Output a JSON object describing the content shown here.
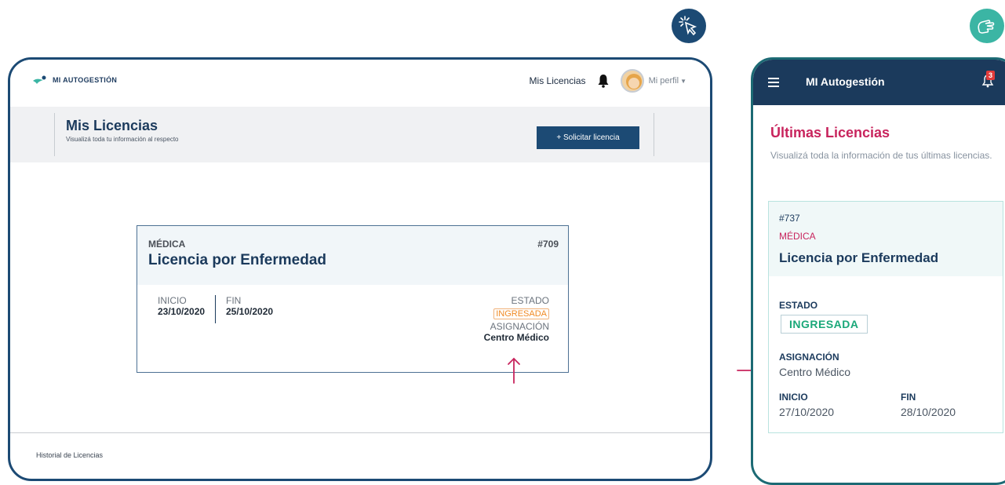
{
  "desktop": {
    "brand": "MI AUTOGESTIÓN",
    "nav_link": "Mis Licencias",
    "profile_label": "Mi perfil",
    "page_title": "Mis Licencias",
    "page_subtitle": "Visualizá toda tu información al respecto",
    "request_button": "+ Solicitar licencia",
    "card": {
      "category": "MÉDICA",
      "number": "#709",
      "title": "Licencia por Enfermedad",
      "start_label": "INICIO",
      "start_value": "23/10/2020",
      "end_label": "FIN",
      "end_value": "25/10/2020",
      "status_label": "ESTADO",
      "status_value": "INGRESADA",
      "assignment_label": "ASIGNACIÓN",
      "assignment_value": "Centro Médico"
    },
    "footer_link": "Historial de Licencias"
  },
  "mobile": {
    "app_title": "MI Autogestión",
    "notification_count": "3",
    "heading": "Últimas Licencias",
    "subtitle": "Visualizá toda la información de tus últimas licencias.",
    "card": {
      "number": "#737",
      "category": "MÉDICA",
      "title": "Licencia por Enfermedad",
      "status_label": "ESTADO",
      "status_value": "INGRESADA",
      "assignment_label": "ASIGNACIÓN",
      "assignment_value": "Centro Médico",
      "start_label": "INICIO",
      "start_value": "27/10/2020",
      "end_label": "FIN",
      "end_value": "28/10/2020"
    }
  },
  "colors": {
    "navy": "#1c4a74",
    "teal": "#3bb5a4",
    "accent_pink": "#c8245d",
    "status_orange": "#f08a24",
    "status_green": "#1aa879"
  },
  "icons": [
    "click-cursor-icon",
    "touch-hand-icon",
    "bell-icon",
    "avatar",
    "hamburger-icon",
    "arrow-up-icon",
    "arrow-right-icon"
  ]
}
